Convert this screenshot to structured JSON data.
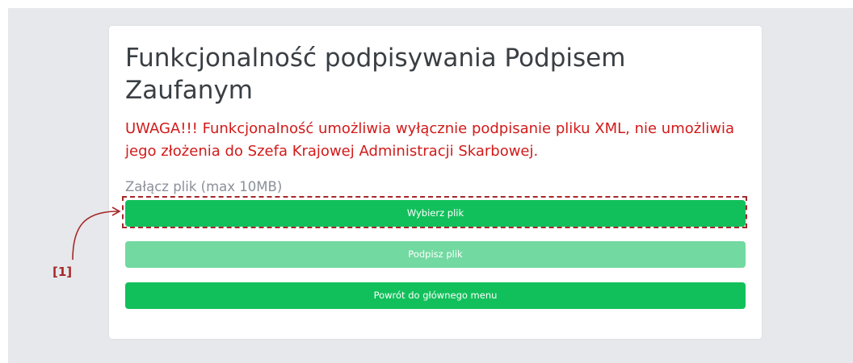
{
  "page": {
    "title": "Funkcjonalność podpisywania Podpisem Zaufanym",
    "warning": "UWAGA!!! Funkcjonalność umożliwia wyłącznie podpisanie pliku XML, nie umożliwia jego złożenia do Szefa Krajowej Administracji Skarbowej.",
    "file_label": "Załącz plik (max 10MB)"
  },
  "buttons": {
    "choose_file": "Wybierz plik",
    "sign_file": "Podpisz plik",
    "back_to_menu": "Powrót do głównego menu"
  },
  "annotation": {
    "marker": "[1]"
  },
  "colors": {
    "primary": "#12c05b",
    "primary_disabled": "#72d9a0",
    "warning": "#d21a1a",
    "annotation": "#a5282a",
    "background": "#e6e8eb"
  }
}
